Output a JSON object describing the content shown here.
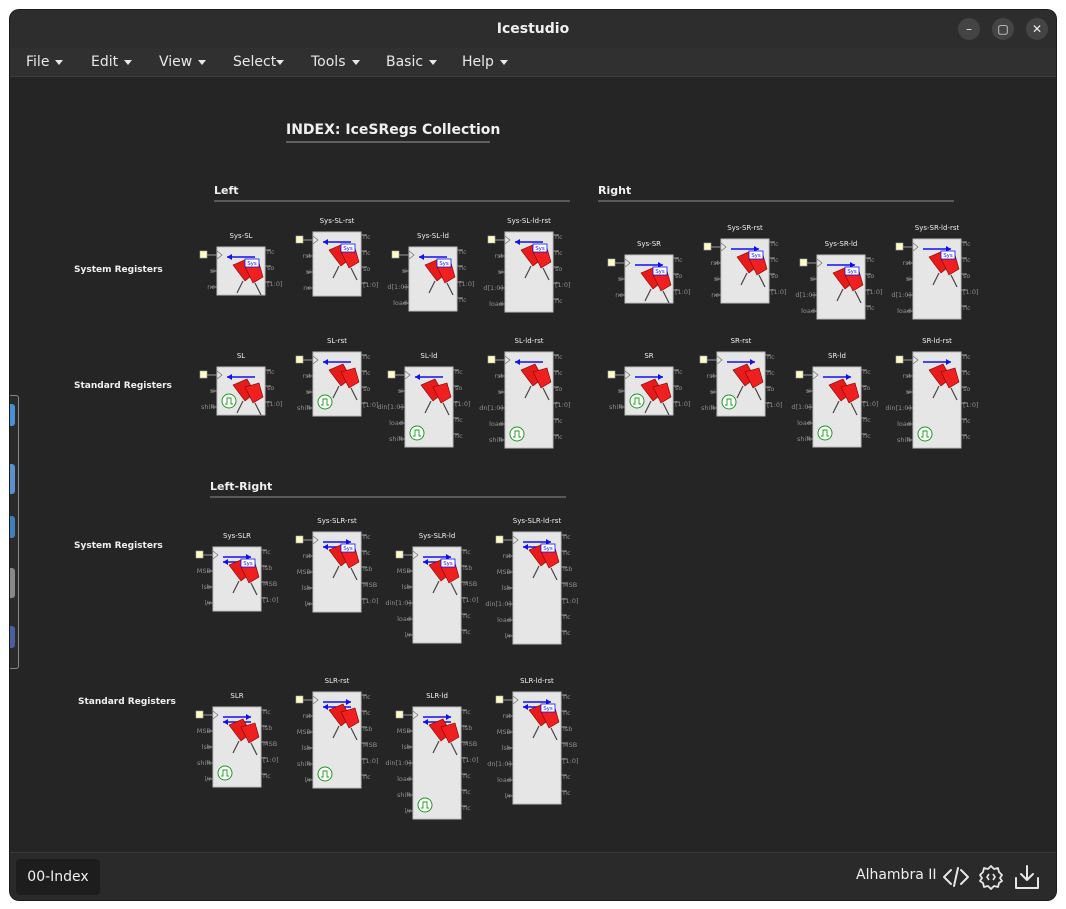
{
  "window": {
    "title": "Icestudio",
    "minimize_icon": "–",
    "maximize_icon": "▢",
    "close_icon": "✕"
  },
  "menu": [
    {
      "label": "File"
    },
    {
      "label": "Edit"
    },
    {
      "label": "View"
    },
    {
      "label": "Select"
    },
    {
      "label": "Tools"
    },
    {
      "label": "Basic"
    },
    {
      "label": "Help"
    }
  ],
  "index_title": "INDEX: IceSRegs Collection",
  "sections": {
    "left": "Left",
    "right": "Right",
    "left_right": "Left-Right"
  },
  "row_labels": {
    "system": "System Registers",
    "standard": "Standard Registers"
  },
  "badge": "Sys",
  "blocks": [
    {
      "title": "Sys-SL",
      "inputs": [
        "",
        "si",
        "nc"
      ],
      "outputs": [
        "nc",
        "so",
        "[1:0]"
      ],
      "arrow": "left",
      "kind": "sys"
    },
    {
      "title": "Sys-SL-rst",
      "inputs": [
        "",
        "rst",
        "si",
        "nc"
      ],
      "outputs": [
        "nc",
        "nc",
        "so",
        "[1:0]"
      ],
      "arrow": "left",
      "kind": "sys"
    },
    {
      "title": "Sys-SL-ld",
      "inputs": [
        "",
        "si",
        "d[1:0]",
        "load"
      ],
      "outputs": [
        "nc",
        "nc",
        "[1:0]",
        "nc"
      ],
      "arrow": "left",
      "kind": "sys"
    },
    {
      "title": "Sys-SL-ld-rst",
      "inputs": [
        "",
        "rst",
        "si",
        "d[1:0]",
        "load"
      ],
      "outputs": [
        "nc",
        "nc",
        "so",
        "[1:0]",
        "nc"
      ],
      "arrow": "left",
      "kind": "sys"
    },
    {
      "title": "Sys-SR",
      "inputs": [
        "",
        "si",
        "nc"
      ],
      "outputs": [
        "nc",
        "so",
        "[1:0]"
      ],
      "arrow": "right",
      "kind": "sys"
    },
    {
      "title": "Sys-SR-rst",
      "inputs": [
        "",
        "rst",
        "si",
        "nc"
      ],
      "outputs": [
        "nc",
        "nc",
        "so",
        "[1:0]"
      ],
      "arrow": "right",
      "kind": "sys"
    },
    {
      "title": "Sys-SR-ld",
      "inputs": [
        "",
        "si",
        "d[1:0]",
        "load"
      ],
      "outputs": [
        "nc",
        "so",
        "[1:0]",
        "nc"
      ],
      "arrow": "right",
      "kind": "sys"
    },
    {
      "title": "Sys-SR-ld-rst",
      "inputs": [
        "",
        "rst",
        "si",
        "d[1:0]",
        "load"
      ],
      "outputs": [
        "nc",
        "nc",
        "so",
        "[1:0]",
        "nc"
      ],
      "arrow": "right",
      "kind": "sys"
    },
    {
      "title": "SL",
      "inputs": [
        "",
        "si",
        "shift"
      ],
      "outputs": [
        "nc",
        "so",
        "[1:0]"
      ],
      "arrow": "left",
      "kind": "std"
    },
    {
      "title": "SL-rst",
      "inputs": [
        "",
        "rst",
        "si",
        "shift"
      ],
      "outputs": [
        "nc",
        "nc",
        "so",
        "[1:0]"
      ],
      "arrow": "left",
      "kind": "std"
    },
    {
      "title": "SL-ld",
      "inputs": [
        "",
        "si",
        "din[1:0]",
        "load",
        "shift"
      ],
      "outputs": [
        "nc",
        "so",
        "[1:0]",
        "nc",
        "nc"
      ],
      "arrow": "left",
      "kind": "std"
    },
    {
      "title": "SL-ld-rst",
      "inputs": [
        "",
        "rst",
        "si",
        "dn[1:0]",
        "load",
        "shift"
      ],
      "outputs": [
        "nc",
        "nc",
        "so",
        "[1:0]",
        "nc",
        "nc"
      ],
      "arrow": "left",
      "kind": "std"
    },
    {
      "title": "SR",
      "inputs": [
        "",
        "si",
        "shift"
      ],
      "outputs": [
        "nc",
        "so",
        "[1:0]"
      ],
      "arrow": "right",
      "kind": "std"
    },
    {
      "title": "SR-rst",
      "inputs": [
        "",
        "rst",
        "si",
        "shift"
      ],
      "outputs": [
        "nc",
        "nc",
        "so",
        "[1:0]"
      ],
      "arrow": "right",
      "kind": "std"
    },
    {
      "title": "SR-ld",
      "inputs": [
        "",
        "si",
        "d[1:0]",
        "load",
        "shift"
      ],
      "outputs": [
        "nc",
        "so",
        "[1:0]",
        "nc",
        "nc"
      ],
      "arrow": "right",
      "kind": "std"
    },
    {
      "title": "SR-ld-rst",
      "inputs": [
        "",
        "rst",
        "si",
        "din[1:0]",
        "load",
        "shift"
      ],
      "outputs": [
        "nc",
        "nc",
        "so",
        "[1:0]",
        "nc",
        "nc"
      ],
      "arrow": "right",
      "kind": "std"
    },
    {
      "title": "Sys-SLR",
      "inputs": [
        "",
        "MSB",
        "lsb",
        "l/r"
      ],
      "outputs": [
        "nc",
        "lsb",
        "MSB",
        "[1:0]"
      ],
      "arrow": "both",
      "kind": "sys"
    },
    {
      "title": "Sys-SLR-rst",
      "inputs": [
        "",
        "rst",
        "MSB",
        "lsb",
        "l/r"
      ],
      "outputs": [
        "nc",
        "nc",
        "lsb",
        "MSB",
        "[1:0]"
      ],
      "arrow": "both",
      "kind": "sys"
    },
    {
      "title": "Sys-SLR-ld",
      "inputs": [
        "",
        "MSB",
        "lsb",
        "din[1:0]",
        "load",
        "l/r"
      ],
      "outputs": [
        "nc",
        "lsb",
        "MSB",
        "[1:0]",
        "nc",
        "nc"
      ],
      "arrow": "both",
      "kind": "sys"
    },
    {
      "title": "Sys-SLR-ld-rst",
      "inputs": [
        "",
        "rst",
        "MSB",
        "lsb",
        "din[1:0]",
        "load",
        "l/r"
      ],
      "outputs": [
        "nc",
        "nc",
        "lsb",
        "MSB",
        "[1:0]",
        "nc",
        "nc"
      ],
      "arrow": "both",
      "kind": "sys"
    },
    {
      "title": "SLR",
      "inputs": [
        "",
        "MSB",
        "lsb",
        "shift",
        "l/r"
      ],
      "outputs": [
        "nc",
        "lsb",
        "MSB",
        "[1:0]",
        "nc"
      ],
      "arrow": "both",
      "kind": "std"
    },
    {
      "title": "SLR-rst",
      "inputs": [
        "",
        "rst",
        "MSB",
        "lsb",
        "shift",
        "l/r"
      ],
      "outputs": [
        "nc",
        "nc",
        "lsb",
        "MSB",
        "[1:0]",
        "nc"
      ],
      "arrow": "both",
      "kind": "std"
    },
    {
      "title": "SLR-ld",
      "inputs": [
        "",
        "MSB",
        "lsb",
        "din[1:0]",
        "load",
        "shift",
        "l/r"
      ],
      "outputs": [
        "nc",
        "lsb",
        "MSB",
        "[1:0]",
        "nc",
        "nc",
        "nc"
      ],
      "arrow": "both",
      "kind": "std"
    },
    {
      "title": "SLR-ld-rst",
      "inputs": [
        "",
        "rst",
        "MSB",
        "lsb",
        "dn[1:0]",
        "load",
        "l/r"
      ],
      "outputs": [
        "nc",
        "nc",
        "lsb",
        "MSB",
        "[1:0]",
        "nc",
        "nc"
      ],
      "arrow": "both",
      "kind": "sys"
    }
  ],
  "status": {
    "tab": "00-Index",
    "board": "Alhambra II"
  },
  "icons": {
    "code": "code-icon",
    "settings": "settings-icon",
    "download": "download-icon"
  }
}
